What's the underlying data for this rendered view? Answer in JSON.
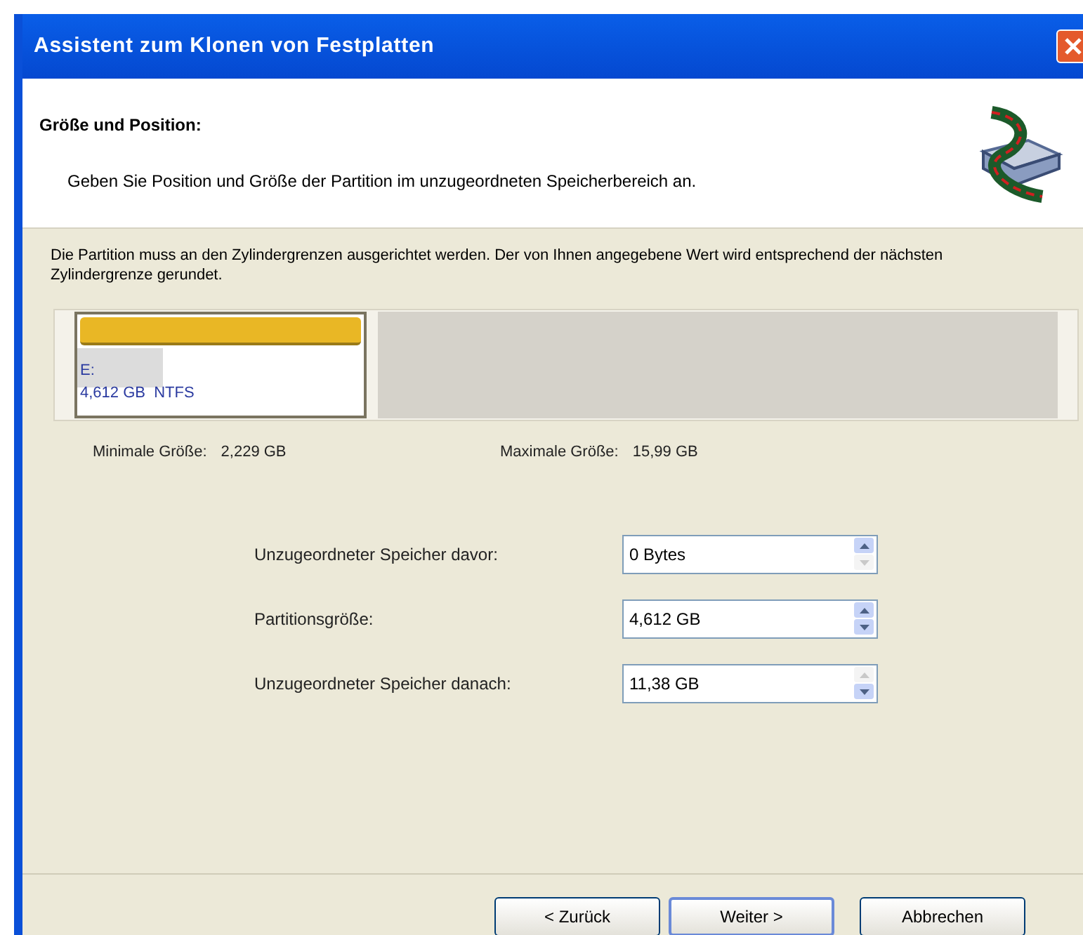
{
  "window": {
    "title": "Assistent zum Klonen von Festplatten"
  },
  "header": {
    "title": "Größe und Position:",
    "description": "Geben Sie Position und Größe der Partition im unzugeordneten Speicherbereich an."
  },
  "note": "Die Partition muss an den Zylindergrenzen ausgerichtet werden. Der von Ihnen angegebene Wert wird entsprechend der nächsten Zylindergrenze gerundet.",
  "partition": {
    "letter": "E:",
    "info": "4,612 GB  NTFS",
    "level": 0.3
  },
  "min_size": {
    "label": "Minimale Größe:",
    "value": "2,229 GB"
  },
  "max_size": {
    "label": "Maximale Größe:",
    "value": "15,99 GB"
  },
  "fields": [
    {
      "label": "Unzugeordneter Speicher davor:",
      "value": "0 Bytes",
      "up_enabled": true,
      "down_enabled": false
    },
    {
      "label": "Partitionsgröße:",
      "value": "4,612 GB",
      "up_enabled": true,
      "down_enabled": true
    },
    {
      "label": "Unzugeordneter Speicher danach:",
      "value": "11,38 GB",
      "up_enabled": false,
      "down_enabled": true
    }
  ],
  "buttons": [
    {
      "label": "< Zurück",
      "selected": false
    },
    {
      "label": "Weiter >",
      "selected": true
    },
    {
      "label": "Abbrechen",
      "selected": false
    }
  ]
}
